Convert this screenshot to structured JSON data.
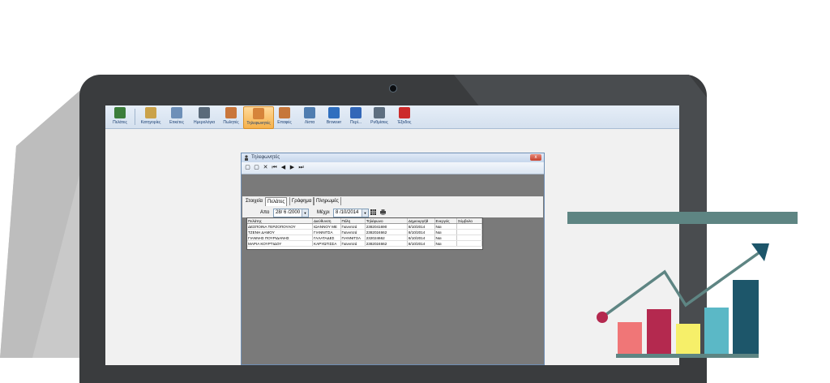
{
  "toolbar": {
    "items": [
      {
        "label": "Πελάτες",
        "icon": "customers-icon",
        "color": "#3b7d3b"
      },
      {
        "label": "Κατηγορίες",
        "icon": "categories-icon",
        "color": "#caa24a"
      },
      {
        "label": "Ετικέτες",
        "icon": "labels-icon",
        "color": "#6d8fb8"
      },
      {
        "label": "Ημερολόγια",
        "icon": "calendar-icon",
        "color": "#5a6a7a"
      },
      {
        "label": "Πωλητές",
        "icon": "salesmen-icon",
        "color": "#c9763b"
      },
      {
        "label": "Τηλεφωνητές",
        "icon": "operators-icon",
        "color": "#d6843a"
      },
      {
        "label": "Επαφές",
        "icon": "contacts-icon",
        "color": "#c6773b"
      },
      {
        "label": "Λίστα",
        "icon": "list-icon",
        "color": "#4f7db0"
      },
      {
        "label": "Browser",
        "icon": "browser-icon",
        "color": "#2f6fbf"
      },
      {
        "label": "Περί...",
        "icon": "help-icon",
        "color": "#3267b8"
      },
      {
        "label": "Ρυθμίσεις",
        "icon": "settings-icon",
        "color": "#5d6e80"
      },
      {
        "label": "Έξοδος",
        "icon": "exit-icon",
        "color": "#cc2b2b"
      }
    ],
    "active_index": 5
  },
  "dialog": {
    "title": "Τηλεφωνητές",
    "close": "x",
    "tools": [
      "▢",
      "▢",
      "✕",
      "⏮",
      "◀",
      "▶",
      "⏭"
    ],
    "tabs": [
      "Στοιχεία",
      "Πελάτες",
      "Γράφημα",
      "Πληρωμές"
    ],
    "selected_tab": 1,
    "filter": {
      "from_label": "Απο",
      "from_value": "28/ 6 /2000",
      "to_label": "Μέχρι",
      "to_value": "8 /10/2014"
    },
    "table": {
      "columns": [
        "Πελάτης",
        "Διεύθυνση",
        "Πόλη",
        "Τηλέφωνο",
        "Δημιουργήθ",
        "Ενεργός",
        "Σύμβολο"
      ],
      "rows": [
        [
          "ΔΕΣΠΟΙΝΑ ΤΕΡΖΟΠΟΥΛΟΥ",
          "ΙΩΑΝΝΟΥ ΜΕ",
          "Γιαννιτσά",
          "2382041690",
          "8/10/2014",
          "Ναι",
          ""
        ],
        [
          "ΤΖΕΝΗ ΔΑΜΟΥ",
          "ΓΙΑΝΝΙΤΣΑ",
          "Γιαννιτσά",
          "2382024662",
          "8/10/2014",
          "Ναι",
          ""
        ],
        [
          "ΓΙΑΝΝΗΣ ΠΟΥΡΙΔΑΝΗΣ",
          "ΓΑΛΑΤΑΔΕΣ",
          "ΓΙΑΝΝΙΤΣΑ",
          "232024662",
          "8/10/2014",
          "Ναι",
          ""
        ],
        [
          "ΜΑΡΙΑ ΚΟΥΡΤΙΔΟΥ",
          "ΚΑΡΥΩΤΙΣΣΑ",
          "Γιαννιτσά",
          "2382024662",
          "8/10/2014",
          "Ναι",
          ""
        ]
      ]
    }
  },
  "colors": {
    "bezel": "#3a3c3e",
    "accent": "#5e8583",
    "bar_pink": "#f07677",
    "bar_crimson": "#b4294f",
    "bar_yellow": "#f6ef69",
    "bar_teal": "#5bb8c6",
    "bar_navy": "#1d566a"
  }
}
